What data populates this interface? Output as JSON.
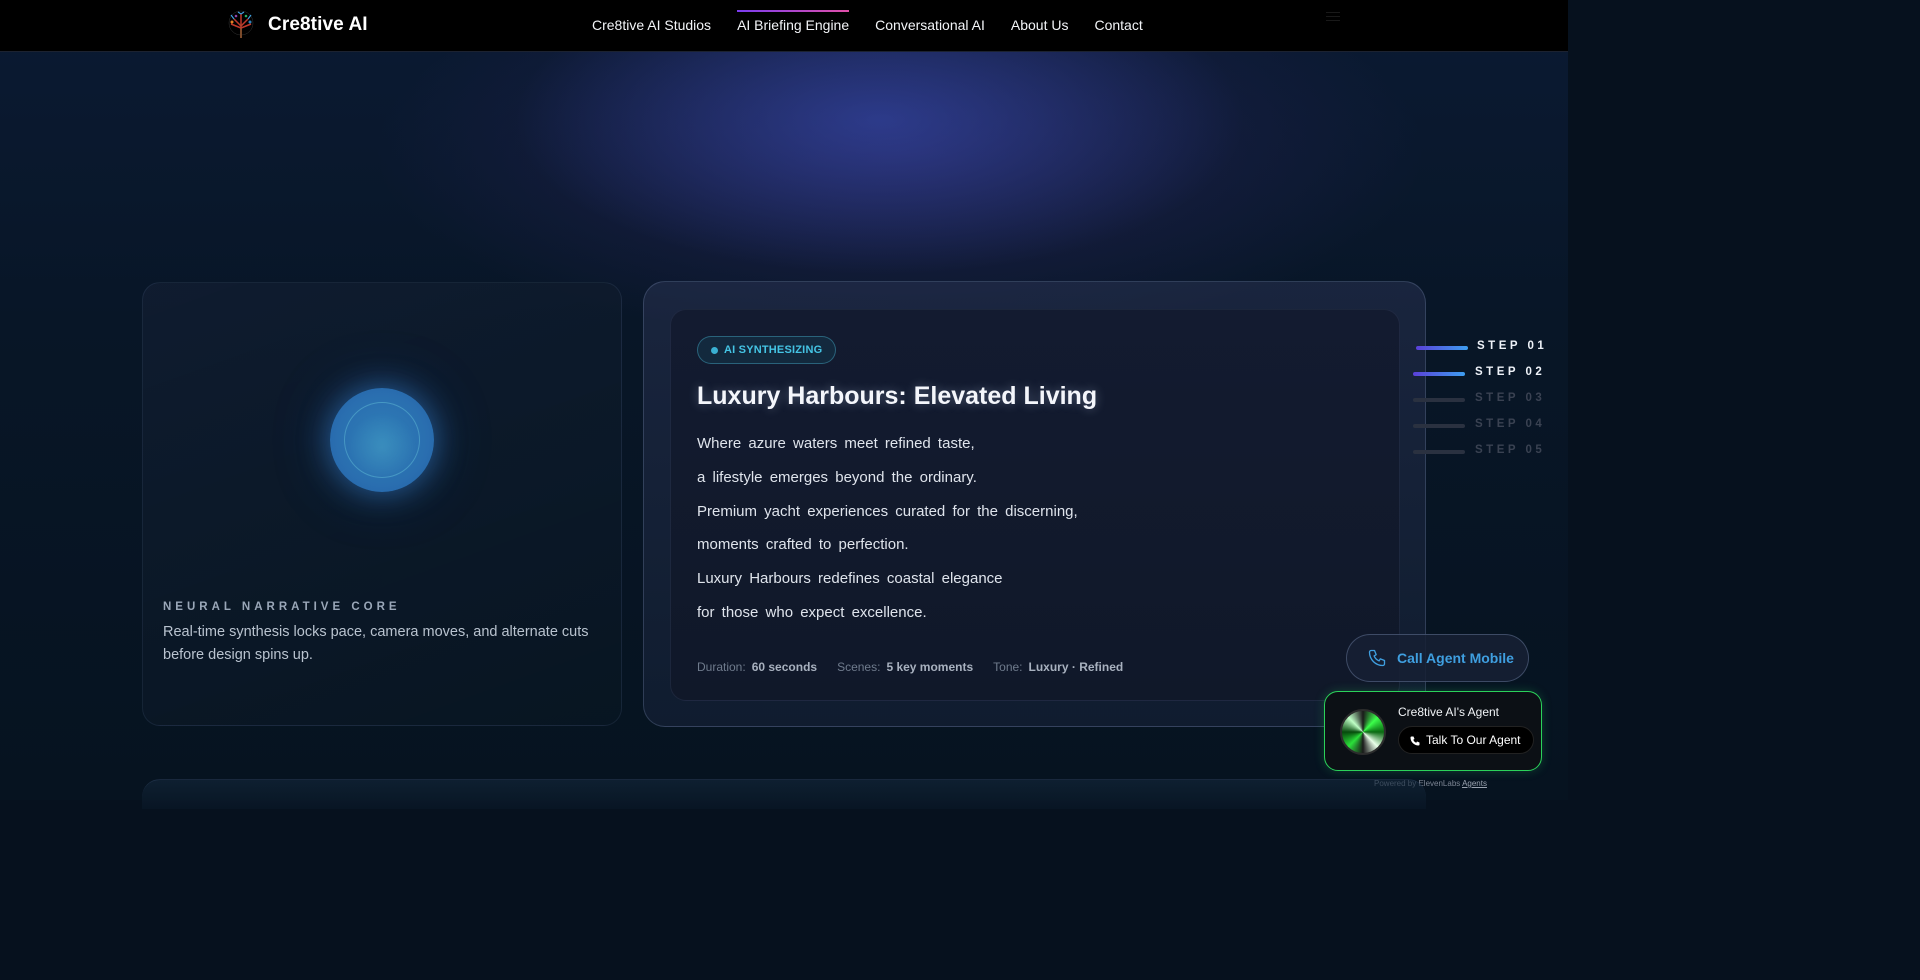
{
  "header": {
    "brand_name": "Cre8tive AI",
    "nav": [
      {
        "label": "Cre8tive AI Studios",
        "active": false
      },
      {
        "label": "AI Briefing Engine",
        "active": true
      },
      {
        "label": "Conversational AI",
        "active": false
      },
      {
        "label": "About Us",
        "active": false
      },
      {
        "label": "Contact",
        "active": false
      }
    ]
  },
  "core": {
    "label": "NEURAL NARRATIVE CORE",
    "description": "Real-time synthesis locks pace, camera moves, and alternate cuts before design spins up."
  },
  "card": {
    "badge": "AI SYNTHESIZING",
    "title": "Luxury Harbours: Elevated Living",
    "lines": [
      "Where azure waters meet refined taste,",
      "a lifestyle emerges beyond the ordinary.",
      "Premium yacht experiences curated for the discerning,",
      "moments crafted to perfection.",
      "Luxury Harbours redefines coastal elegance",
      "for those who expect excellence."
    ],
    "meta": {
      "duration_label": "Duration:",
      "duration_value": "60 seconds",
      "scenes_label": "Scenes:",
      "scenes_value": "5 key moments",
      "tone_label": "Tone:",
      "tone_value": "Luxury · Refined"
    }
  },
  "steps": [
    {
      "label": "STEP 01",
      "active": true
    },
    {
      "label": "STEP 02",
      "active": true
    },
    {
      "label": "STEP 03",
      "active": false
    },
    {
      "label": "STEP 04",
      "active": false
    },
    {
      "label": "STEP 05",
      "active": false
    }
  ],
  "call_button": {
    "label": "Call Agent Mobile"
  },
  "agent_widget": {
    "name": "Cre8tive AI's Agent",
    "talk_label": "Talk To Our Agent",
    "powered_prefix": "Powered by ElevenLabs",
    "powered_link": "Agents"
  },
  "colors": {
    "accent_cyan": "#45c5e5",
    "accent_blue": "#3f9fe0",
    "widget_green": "#2bd25a",
    "nav_underline": "#e14fa8"
  }
}
